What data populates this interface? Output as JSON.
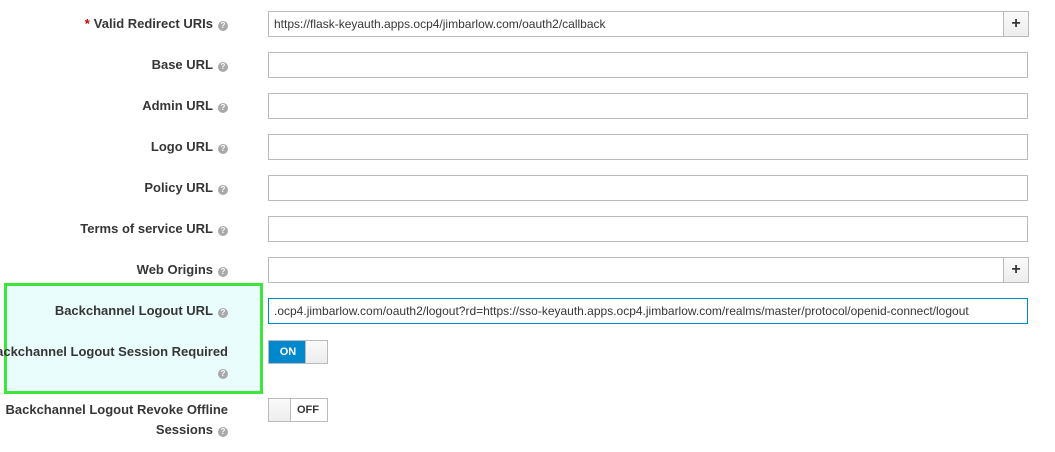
{
  "fields": {
    "redirect": {
      "label": "Valid Redirect URIs",
      "required": "*",
      "value": "https://flask-keyauth.apps.ocp4/jimbarlow.com/oauth2/callback"
    },
    "base_url": {
      "label": "Base URL",
      "value": ""
    },
    "admin_url": {
      "label": "Admin URL",
      "value": ""
    },
    "logo_url": {
      "label": "Logo URL",
      "value": ""
    },
    "policy_url": {
      "label": "Policy URL",
      "value": ""
    },
    "tos_url": {
      "label": "Terms of service URL",
      "value": ""
    },
    "web_origins": {
      "label": "Web Origins",
      "value": ""
    },
    "backchannel_url": {
      "label": "Backchannel Logout URL",
      "value": ".ocp4.jimbarlow.com/oauth2/logout?rd=https://sso-keyauth.apps.ocp4.jimbarlow.com/realms/master/protocol/openid-connect/logout"
    },
    "backchannel_session": {
      "label": "Backchannel Logout Session Required",
      "state": "ON"
    },
    "backchannel_revoke": {
      "label_line1": "Backchannel Logout Revoke Offline",
      "label_line2": "Sessions",
      "state": "OFF"
    }
  },
  "add_button_label": "+",
  "help_glyph": "?",
  "colors": {
    "accent": "#0088ce",
    "highlight_border": "#3ce63c",
    "highlight_bg": "#eafdfd",
    "required": "#cc0000"
  }
}
